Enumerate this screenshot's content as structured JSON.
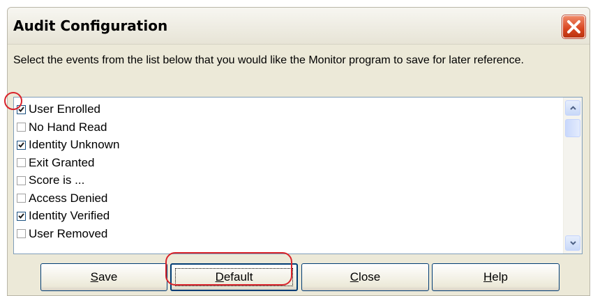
{
  "window": {
    "title": "Audit Configuration",
    "close_icon": "close-icon"
  },
  "description": "Select the events from the list below that you would like the Monitor program to save for later reference.",
  "events": [
    {
      "label": "User Enrolled",
      "checked": true
    },
    {
      "label": "No Hand Read",
      "checked": false
    },
    {
      "label": "Identity Unknown",
      "checked": true
    },
    {
      "label": "Exit Granted",
      "checked": false
    },
    {
      "label": "Score is ...",
      "checked": false
    },
    {
      "label": "Access Denied",
      "checked": false
    },
    {
      "label": "Identity Verified",
      "checked": true
    },
    {
      "label": "User Removed",
      "checked": false
    }
  ],
  "buttons": {
    "save": {
      "mnemonic": "S",
      "rest": "ave"
    },
    "default": {
      "mnemonic": "D",
      "rest": "efault"
    },
    "close": {
      "mnemonic": "C",
      "rest": "lose"
    },
    "help": {
      "mnemonic": "H",
      "rest": "elp"
    }
  },
  "colors": {
    "annotation": "#d8232a",
    "window_bg": "#ece9d8",
    "close_button": "#d8451f"
  }
}
